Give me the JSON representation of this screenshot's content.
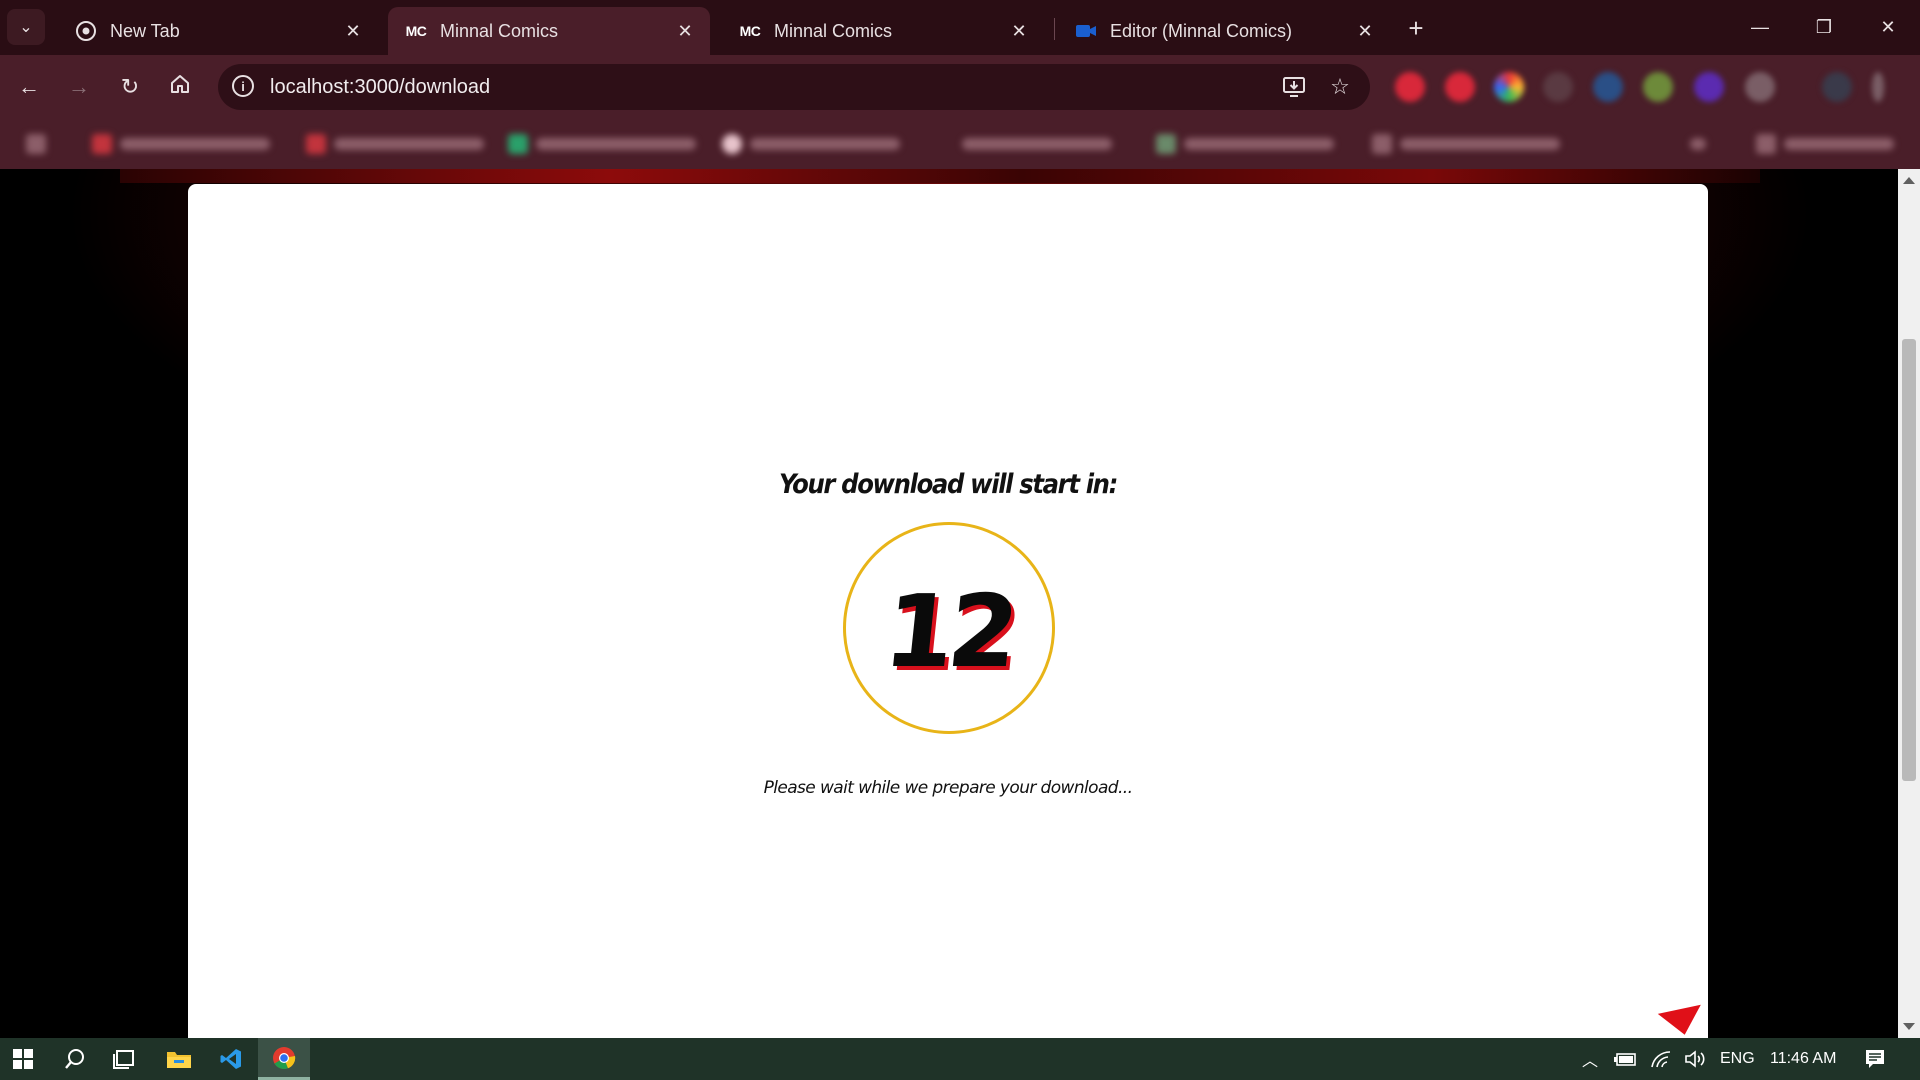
{
  "browser": {
    "tabs": [
      {
        "title": "New Tab",
        "favicon": "chrome-icon",
        "active": false
      },
      {
        "title": "Minnal Comics",
        "favicon": "MC",
        "active": true
      },
      {
        "title": "Minnal Comics",
        "favicon": "MC",
        "active": false
      },
      {
        "title": "Editor (Minnal Comics)",
        "favicon": "video-editor-icon",
        "active": false
      }
    ],
    "url": "localhost:3000/download"
  },
  "page": {
    "heading": "Your download will start in:",
    "countdown": "12",
    "message": "Please wait while we prepare your download..."
  },
  "taskbar": {
    "language": "ENG",
    "time": "11:46 AM"
  },
  "colors": {
    "ring": "#e8b418",
    "count_shadow": "#d8101c",
    "chrome_dark": "#2a0d14",
    "chrome_mid": "#4a1e29"
  }
}
